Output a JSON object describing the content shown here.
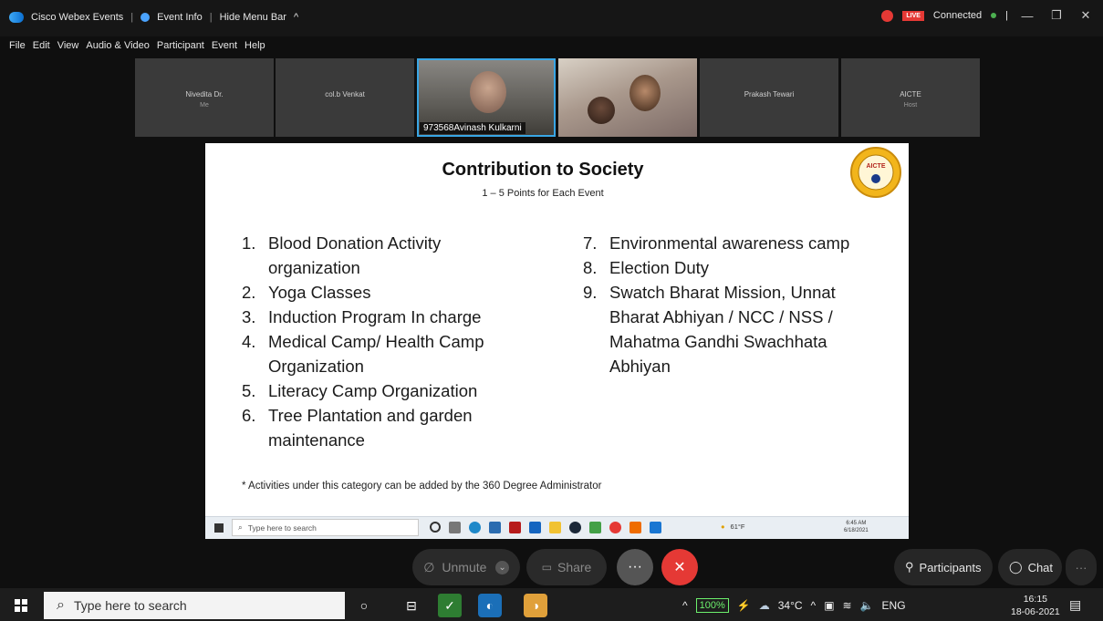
{
  "titlebar": {
    "app_name": "Cisco Webex Events",
    "event_info": "Event Info",
    "hide_menu": "Hide Menu Bar",
    "connected": "Connected",
    "live": "LIVE"
  },
  "menu": [
    "File",
    "Edit",
    "View",
    "Audio & Video",
    "Participant",
    "Event",
    "Help"
  ],
  "participants": [
    {
      "name": "Nivedita Dr.",
      "role": "Me"
    },
    {
      "name": "col.b Venkat",
      "role": ""
    },
    {
      "name": "973568Avinash Kulkarni",
      "role": ""
    },
    {
      "name": "",
      "role": ""
    },
    {
      "name": "Prakash Tewari",
      "role": ""
    },
    {
      "name": "AICTE",
      "role": "Host"
    }
  ],
  "slide": {
    "title": "Contribution to Society",
    "subtitle": "1 – 5 Points for Each Event",
    "logo_text": "AICTE",
    "left_items": [
      {
        "num": "1.",
        "text": "Blood Donation Activity organization"
      },
      {
        "num": "2.",
        "text": "Yoga Classes"
      },
      {
        "num": "3.",
        "text": "Induction Program In charge"
      },
      {
        "num": "4.",
        "text": "Medical Camp/ Health Camp Organization"
      },
      {
        "num": "5.",
        "text": "Literacy Camp Organization"
      },
      {
        "num": "6.",
        "text": "Tree Plantation and garden maintenance"
      }
    ],
    "right_items": [
      {
        "num": "7.",
        "text": "Environmental awareness camp"
      },
      {
        "num": "8.",
        "text": "Election Duty"
      },
      {
        "num": "9.",
        "text": "Swatch Bharat Mission, Unnat Bharat Abhiyan / NCC / NSS / Mahatma Gandhi Swachhata Abhiyan"
      }
    ],
    "footnote": "* Activities under this category can be added by the 360 Degree Administrator",
    "inner_taskbar": {
      "search": "Type here to search",
      "temp": "61°F",
      "time": "6:45 AM",
      "date": "6/18/2021"
    }
  },
  "controls": {
    "unmute": "Unmute",
    "share": "Share",
    "more": "···",
    "leave": "✕",
    "participants": "Participants",
    "chat": "Chat",
    "overflow": "···"
  },
  "taskbar": {
    "search": "Type here to search",
    "battery": "100%",
    "temperature": "34°C",
    "language": "ENG",
    "time": "16:15",
    "date": "18-06-2021"
  },
  "colors": {
    "accent": "#39a6e5",
    "leave": "#e53935",
    "connected": "#4caf50"
  }
}
